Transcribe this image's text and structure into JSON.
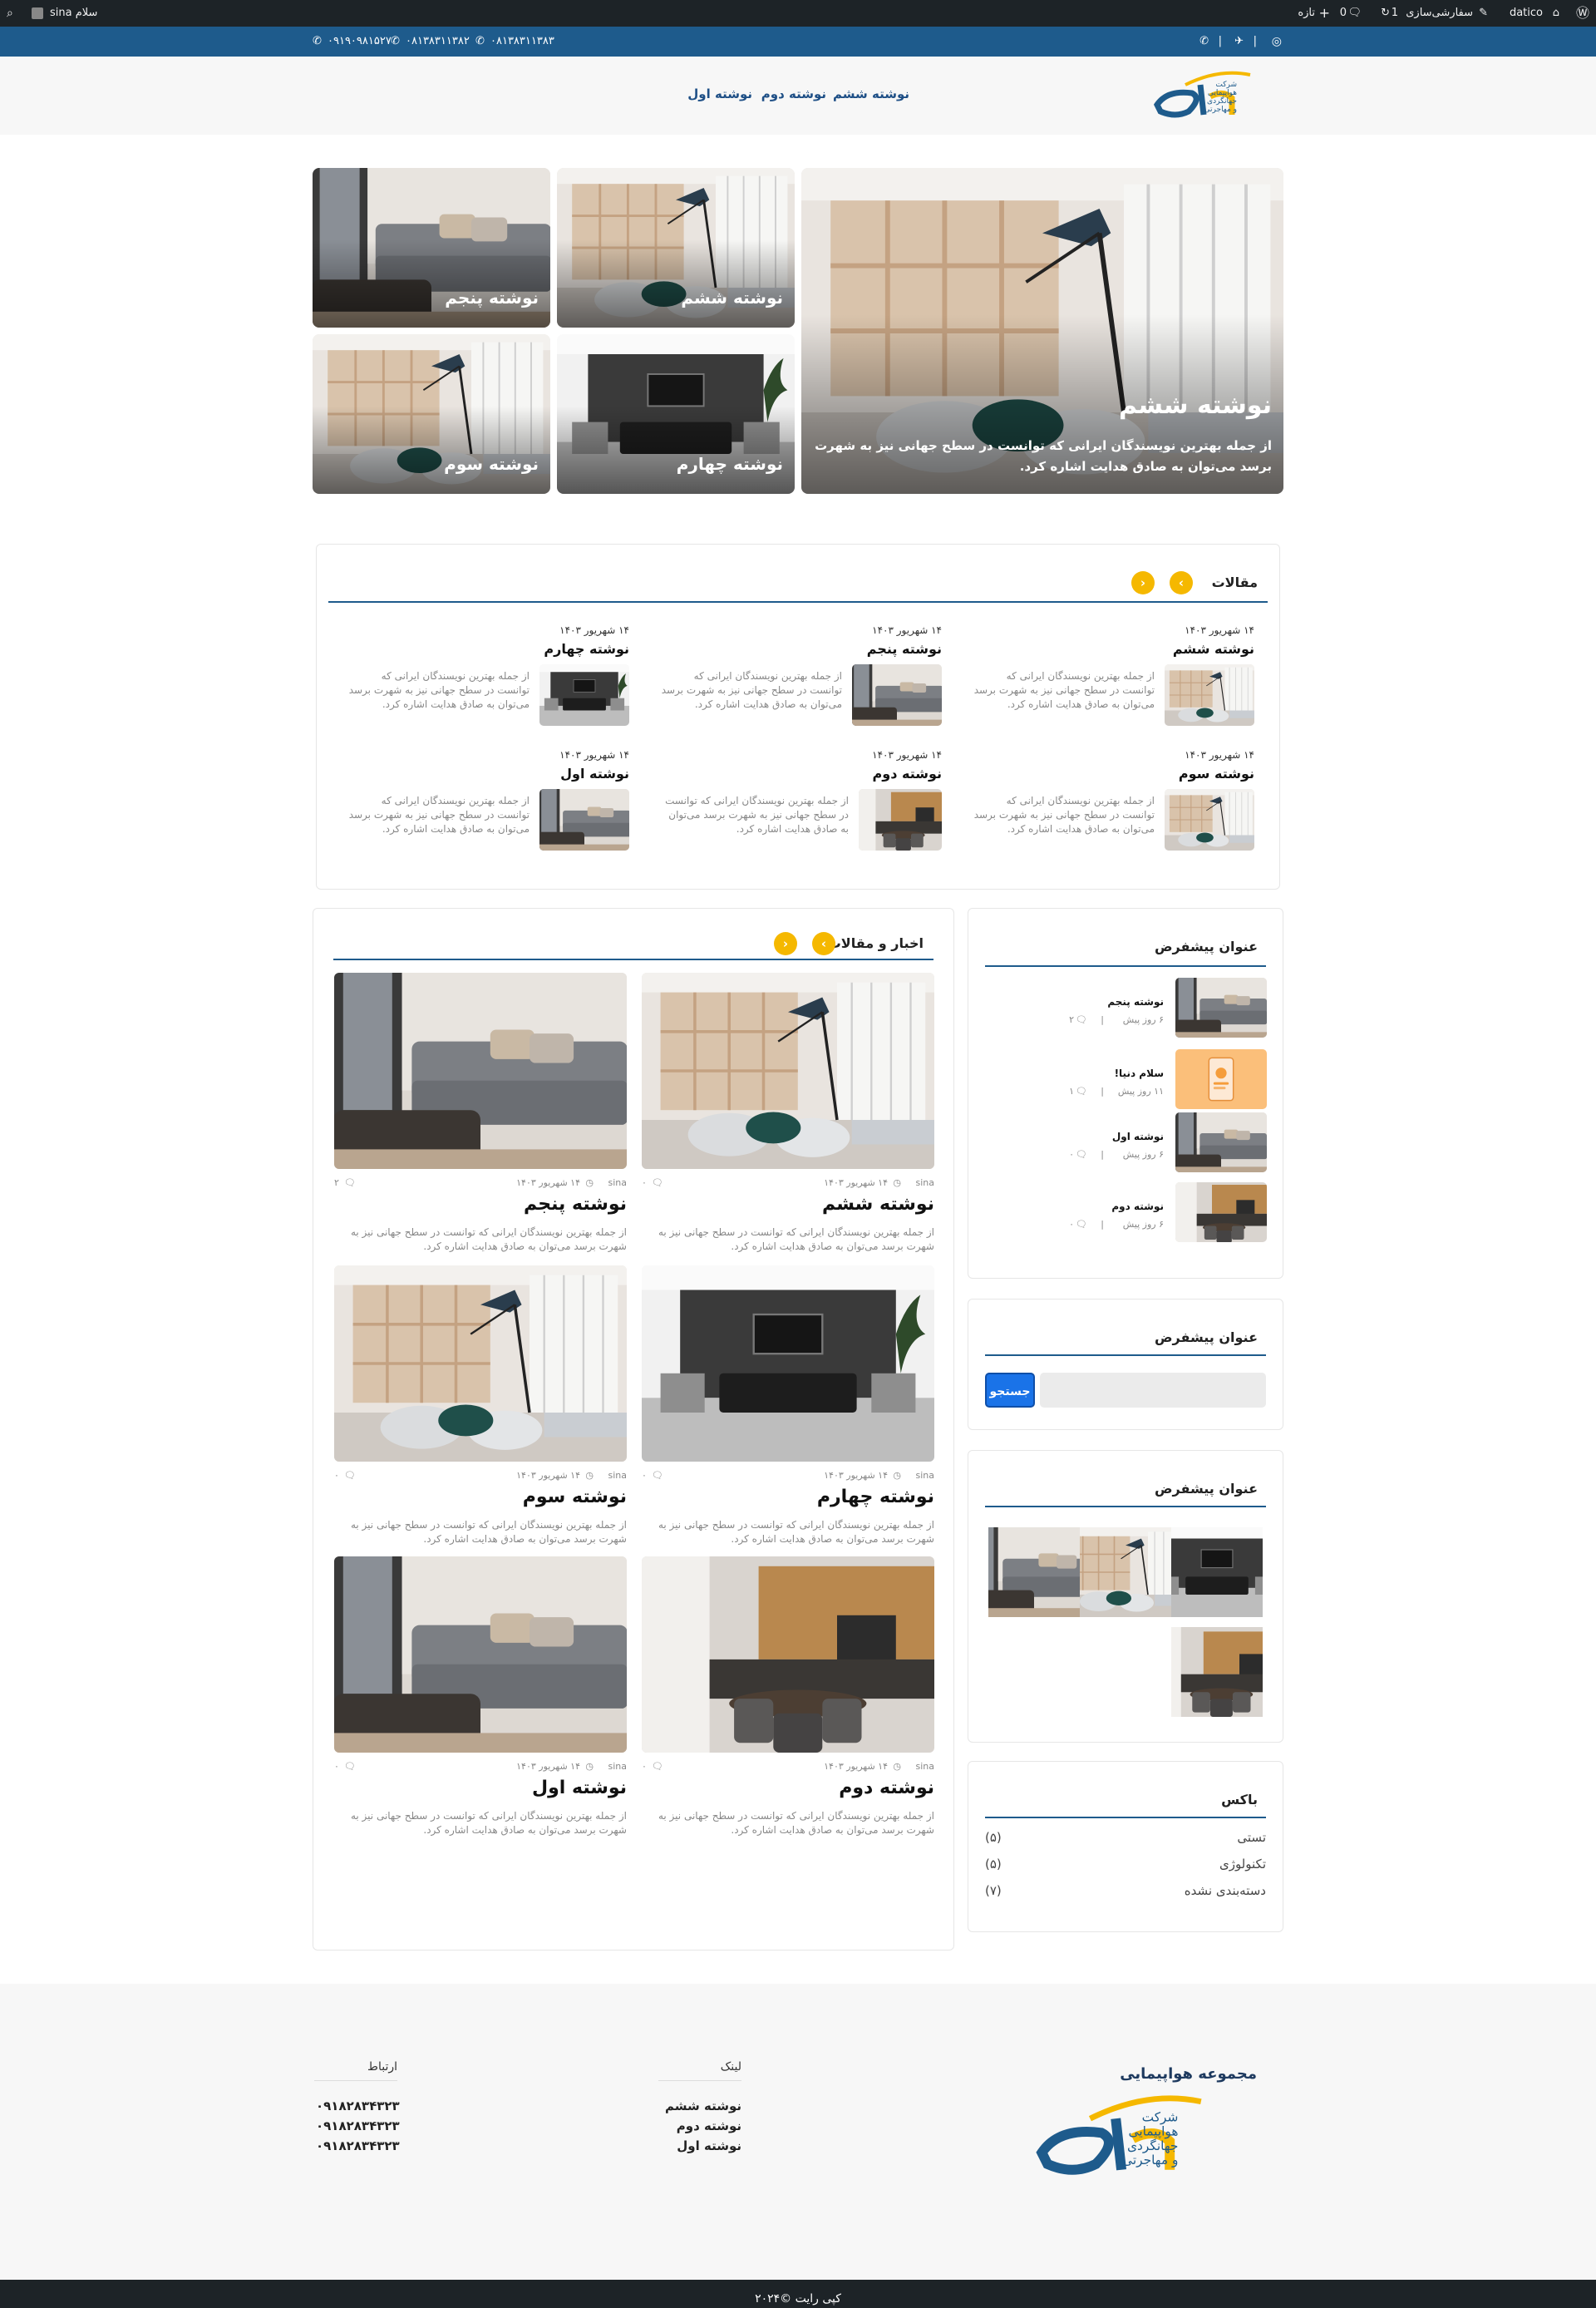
{
  "admin_bar": {
    "greeting": "سلام sina",
    "site_name": "datico",
    "customize": "سفارشی‌سازی",
    "updates": "1",
    "comments": "0",
    "new": "تازه"
  },
  "top_bar": {
    "phones": [
      "۰۸۱۳۸۳۱۱۳۸۳",
      "۰۸۱۳۸۳۱۱۳۸۲",
      "۰۹۱۹۰۹۸۱۵۲۷"
    ]
  },
  "nav": {
    "items": [
      "نوشته ششم",
      "نوشته دوم",
      "نوشته اول"
    ]
  },
  "hero": {
    "main": {
      "title": "نوشته ششم",
      "excerpt": "از جمله بهترین نویسندگان ایرانی که توانست در سطح جهانی نیز به شهرت برسد می‌توان به صادق هدایت اشاره کرد."
    },
    "tiles": [
      "نوشته ششم",
      "نوشته پنجم",
      "نوشته چهارم",
      "نوشته سوم"
    ]
  },
  "articles": {
    "heading": "مقالات",
    "items": [
      {
        "date": "۱۴ شهریور ۱۴۰۳",
        "title": "نوشته ششم",
        "excerpt": "از جمله بهترین نویسندگان ایرانی که توانست در سطح جهانی نیز به شهرت برسد می‌توان به صادق هدایت اشاره کرد."
      },
      {
        "date": "۱۴ شهریور ۱۴۰۳",
        "title": "نوشته پنجم",
        "excerpt": "از جمله بهترین نویسندگان ایرانی که توانست در سطح جهانی نیز به شهرت برسد می‌توان به صادق هدایت اشاره کرد."
      },
      {
        "date": "۱۴ شهریور ۱۴۰۳",
        "title": "نوشته چهارم",
        "excerpt": "از جمله بهترین نویسندگان ایرانی که توانست در سطح جهانی نیز به شهرت برسد می‌توان به صادق هدایت اشاره کرد."
      },
      {
        "date": "۱۴ شهریور ۱۴۰۳",
        "title": "نوشته سوم",
        "excerpt": "از جمله بهترین نویسندگان ایرانی که توانست در سطح جهانی نیز به شهرت برسد می‌توان به صادق هدایت اشاره کرد."
      },
      {
        "date": "۱۴ شهریور ۱۴۰۳",
        "title": "نوشته دوم",
        "excerpt": "از جمله بهترین نویسندگان ایرانی که توانست در سطح جهانی نیز به شهرت برسد می‌توان به صادق هدایت اشاره کرد."
      },
      {
        "date": "۱۴ شهریور ۱۴۰۳",
        "title": "نوشته اول",
        "excerpt": "از جمله بهترین نویسندگان ایرانی که توانست در سطح جهانی نیز به شهرت برسد می‌توان به صادق هدایت اشاره کرد."
      }
    ]
  },
  "news": {
    "heading": "اخبار و مقالات",
    "posts": [
      {
        "title": "نوشته ششم",
        "author": "sina",
        "date": "۱۴ شهریور ۱۴۰۳",
        "comments": "۰",
        "excerpt": "از جمله بهترین نویسندگان ایرانی که توانست در سطح جهانی نیز به شهرت برسد می‌توان به صادق هدایت اشاره کرد."
      },
      {
        "title": "نوشته پنجم",
        "author": "sina",
        "date": "۱۴ شهریور ۱۴۰۳",
        "comments": "۲",
        "excerpt": "از جمله بهترین نویسندگان ایرانی که توانست در سطح جهانی نیز به شهرت برسد می‌توان به صادق هدایت اشاره کرد."
      },
      {
        "title": "نوشته چهارم",
        "author": "sina",
        "date": "۱۴ شهریور ۱۴۰۳",
        "comments": "۰",
        "excerpt": "از جمله بهترین نویسندگان ایرانی که توانست در سطح جهانی نیز به شهرت برسد می‌توان به صادق هدایت اشاره کرد."
      },
      {
        "title": "نوشته سوم",
        "author": "sina",
        "date": "۱۴ شهریور ۱۴۰۳",
        "comments": "۰",
        "excerpt": "از جمله بهترین نویسندگان ایرانی که توانست در سطح جهانی نیز به شهرت برسد می‌توان به صادق هدایت اشاره کرد."
      },
      {
        "title": "نوشته دوم",
        "author": "sina",
        "date": "۱۴ شهریور ۱۴۰۳",
        "comments": "۰",
        "excerpt": "از جمله بهترین نویسندگان ایرانی که توانست در سطح جهانی نیز به شهرت برسد می‌توان به صادق هدایت اشاره کرد."
      },
      {
        "title": "نوشته اول",
        "author": "sina",
        "date": "۱۴ شهریور ۱۴۰۳",
        "comments": "۰",
        "excerpt": "از جمله بهترین نویسندگان ایرانی که توانست در سطح جهانی نیز به شهرت برسد می‌توان به صادق هدایت اشاره کرد."
      }
    ]
  },
  "sidebar": {
    "recent": {
      "heading": "عنوان پیشفرض",
      "items": [
        {
          "title": "نوشته پنجم",
          "ago": "۶ روز پیش",
          "comments": "۲"
        },
        {
          "title": "سلام دنیا!",
          "ago": "۱۱ روز پیش",
          "comments": "۱"
        },
        {
          "title": "نوشته اول",
          "ago": "۶ روز پیش",
          "comments": "۰"
        },
        {
          "title": "نوشته دوم",
          "ago": "۶ روز پیش",
          "comments": "۰"
        }
      ]
    },
    "search": {
      "heading": "عنوان پیشفرض",
      "button": "جستجو",
      "placeholder": ""
    },
    "gallery": {
      "heading": "عنوان پیشفرض"
    },
    "categories": {
      "heading": "باکس",
      "items": [
        {
          "name": "تستی",
          "count": "(۵)"
        },
        {
          "name": "تکنولوژی",
          "count": "(۵)"
        },
        {
          "name": "دسته‌بندی نشده",
          "count": "(۷)"
        }
      ]
    }
  },
  "footer": {
    "brand_title": "مجموعه هواپیمایی",
    "logo_text": [
      "شرکت",
      "هواپیمایی",
      "جهانگردی",
      "و مهاجرتی"
    ],
    "links_heading": "لینک",
    "links": [
      "نوشته ششم",
      "نوشته دوم",
      "نوشته اول"
    ],
    "contact_heading": "ارتباط",
    "contacts": [
      "۰۹۱۸۲۸۳۴۳۲۳",
      "۰۹۱۸۲۸۳۴۳۲۳",
      "۰۹۱۸۲۸۳۴۳۲۳"
    ],
    "copyright": "کپی رایت ©۲۰۲۴"
  },
  "colors": {
    "brand_blue": "#1e5b8c",
    "accent_yellow": "#f5b800",
    "button_blue": "#1a73e8"
  }
}
